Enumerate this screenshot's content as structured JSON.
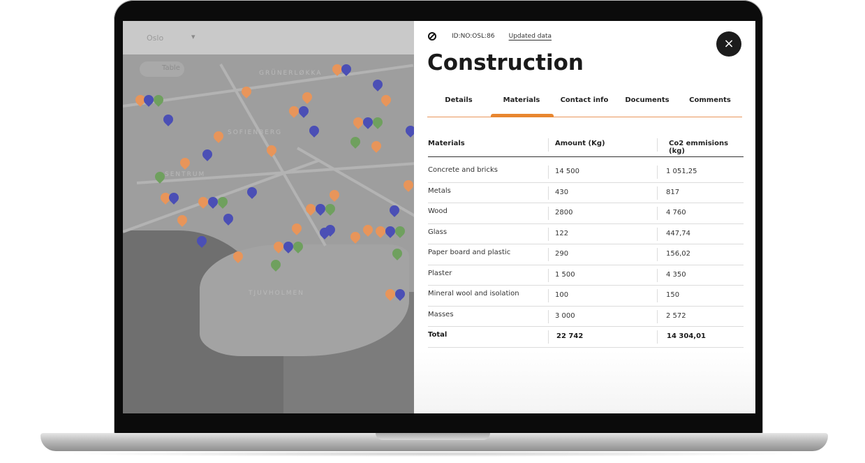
{
  "map": {
    "city": "Oslo",
    "table_button": "Table",
    "labels": [
      "GRÜNERLØKKA",
      "SOFIENBERG",
      "TJUVHOLMEN",
      "SENTRUM"
    ]
  },
  "panel": {
    "id": "ID:NO:OSL:86",
    "updated_link": "Updated data",
    "title": "Construction",
    "close_icon": "×",
    "tabs": [
      "Details",
      "Materials",
      "Contact info",
      "Documents",
      "Comments"
    ],
    "active_tab": "Materials",
    "table": {
      "headers": [
        "Materials",
        "Amount (Kg)",
        "Co2 emmisions (kg)"
      ],
      "rows": [
        [
          "Concrete and bricks",
          "14 500",
          "1 051,25"
        ],
        [
          "Metals",
          "430",
          "817"
        ],
        [
          "Wood",
          "2800",
          "4 760"
        ],
        [
          "Glass",
          "122",
          "447,74"
        ],
        [
          "Paper board and plastic",
          "290",
          "156,02"
        ],
        [
          "Plaster",
          "1 500",
          "4 350"
        ],
        [
          "Mineral wool and isolation",
          "100",
          "150"
        ],
        [
          "Masses",
          "3 000",
          "2 572"
        ]
      ],
      "total": [
        "Total",
        "22 742",
        "14 304,01"
      ]
    }
  },
  "colors": {
    "accent": "#e8862f",
    "pin_orange": "#e8955a",
    "pin_blue": "#4b4fb5",
    "pin_green": "#6fa05e"
  }
}
